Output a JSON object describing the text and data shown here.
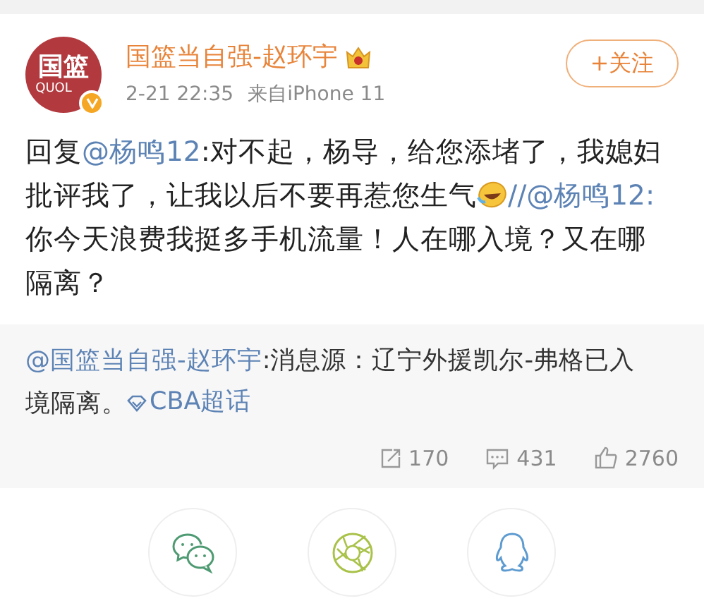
{
  "post": {
    "author": "国篮当自强-赵环宇",
    "avatar_text": "国篮",
    "avatar_subtext": "QUOL",
    "time": "2-21 22:35",
    "source": "来自iPhone 11",
    "follow_button": "+关注",
    "body": [
      {
        "kind": "text",
        "text": "回复"
      },
      {
        "kind": "mention",
        "text": "@杨鸣12"
      },
      {
        "kind": "text",
        "text": ":对不起，杨导，给您添堵了，我媳妇批评我了，让我以后不要再惹您生气"
      },
      {
        "kind": "emoji"
      },
      {
        "kind": "mention",
        "text": "//@杨鸣12:"
      },
      {
        "kind": "text",
        "text": "你今天浪费我挺多手机流量！人在哪入境？又在哪隔离？"
      }
    ],
    "quoted": [
      {
        "kind": "mention",
        "text": "@国篮当自强-赵环宇"
      },
      {
        "kind": "text",
        "text": ":消息源：辽宁外援凯尔-弗格已入境隔离。"
      },
      {
        "kind": "topic",
        "text": "CBA超话"
      }
    ],
    "stats": [
      {
        "kind": "repost",
        "text": "170"
      },
      {
        "kind": "comment",
        "text": "431"
      },
      {
        "kind": "like",
        "text": "2760"
      }
    ]
  },
  "share": [
    {
      "kind": "wechat"
    },
    {
      "kind": "moments"
    },
    {
      "kind": "qq"
    }
  ]
}
